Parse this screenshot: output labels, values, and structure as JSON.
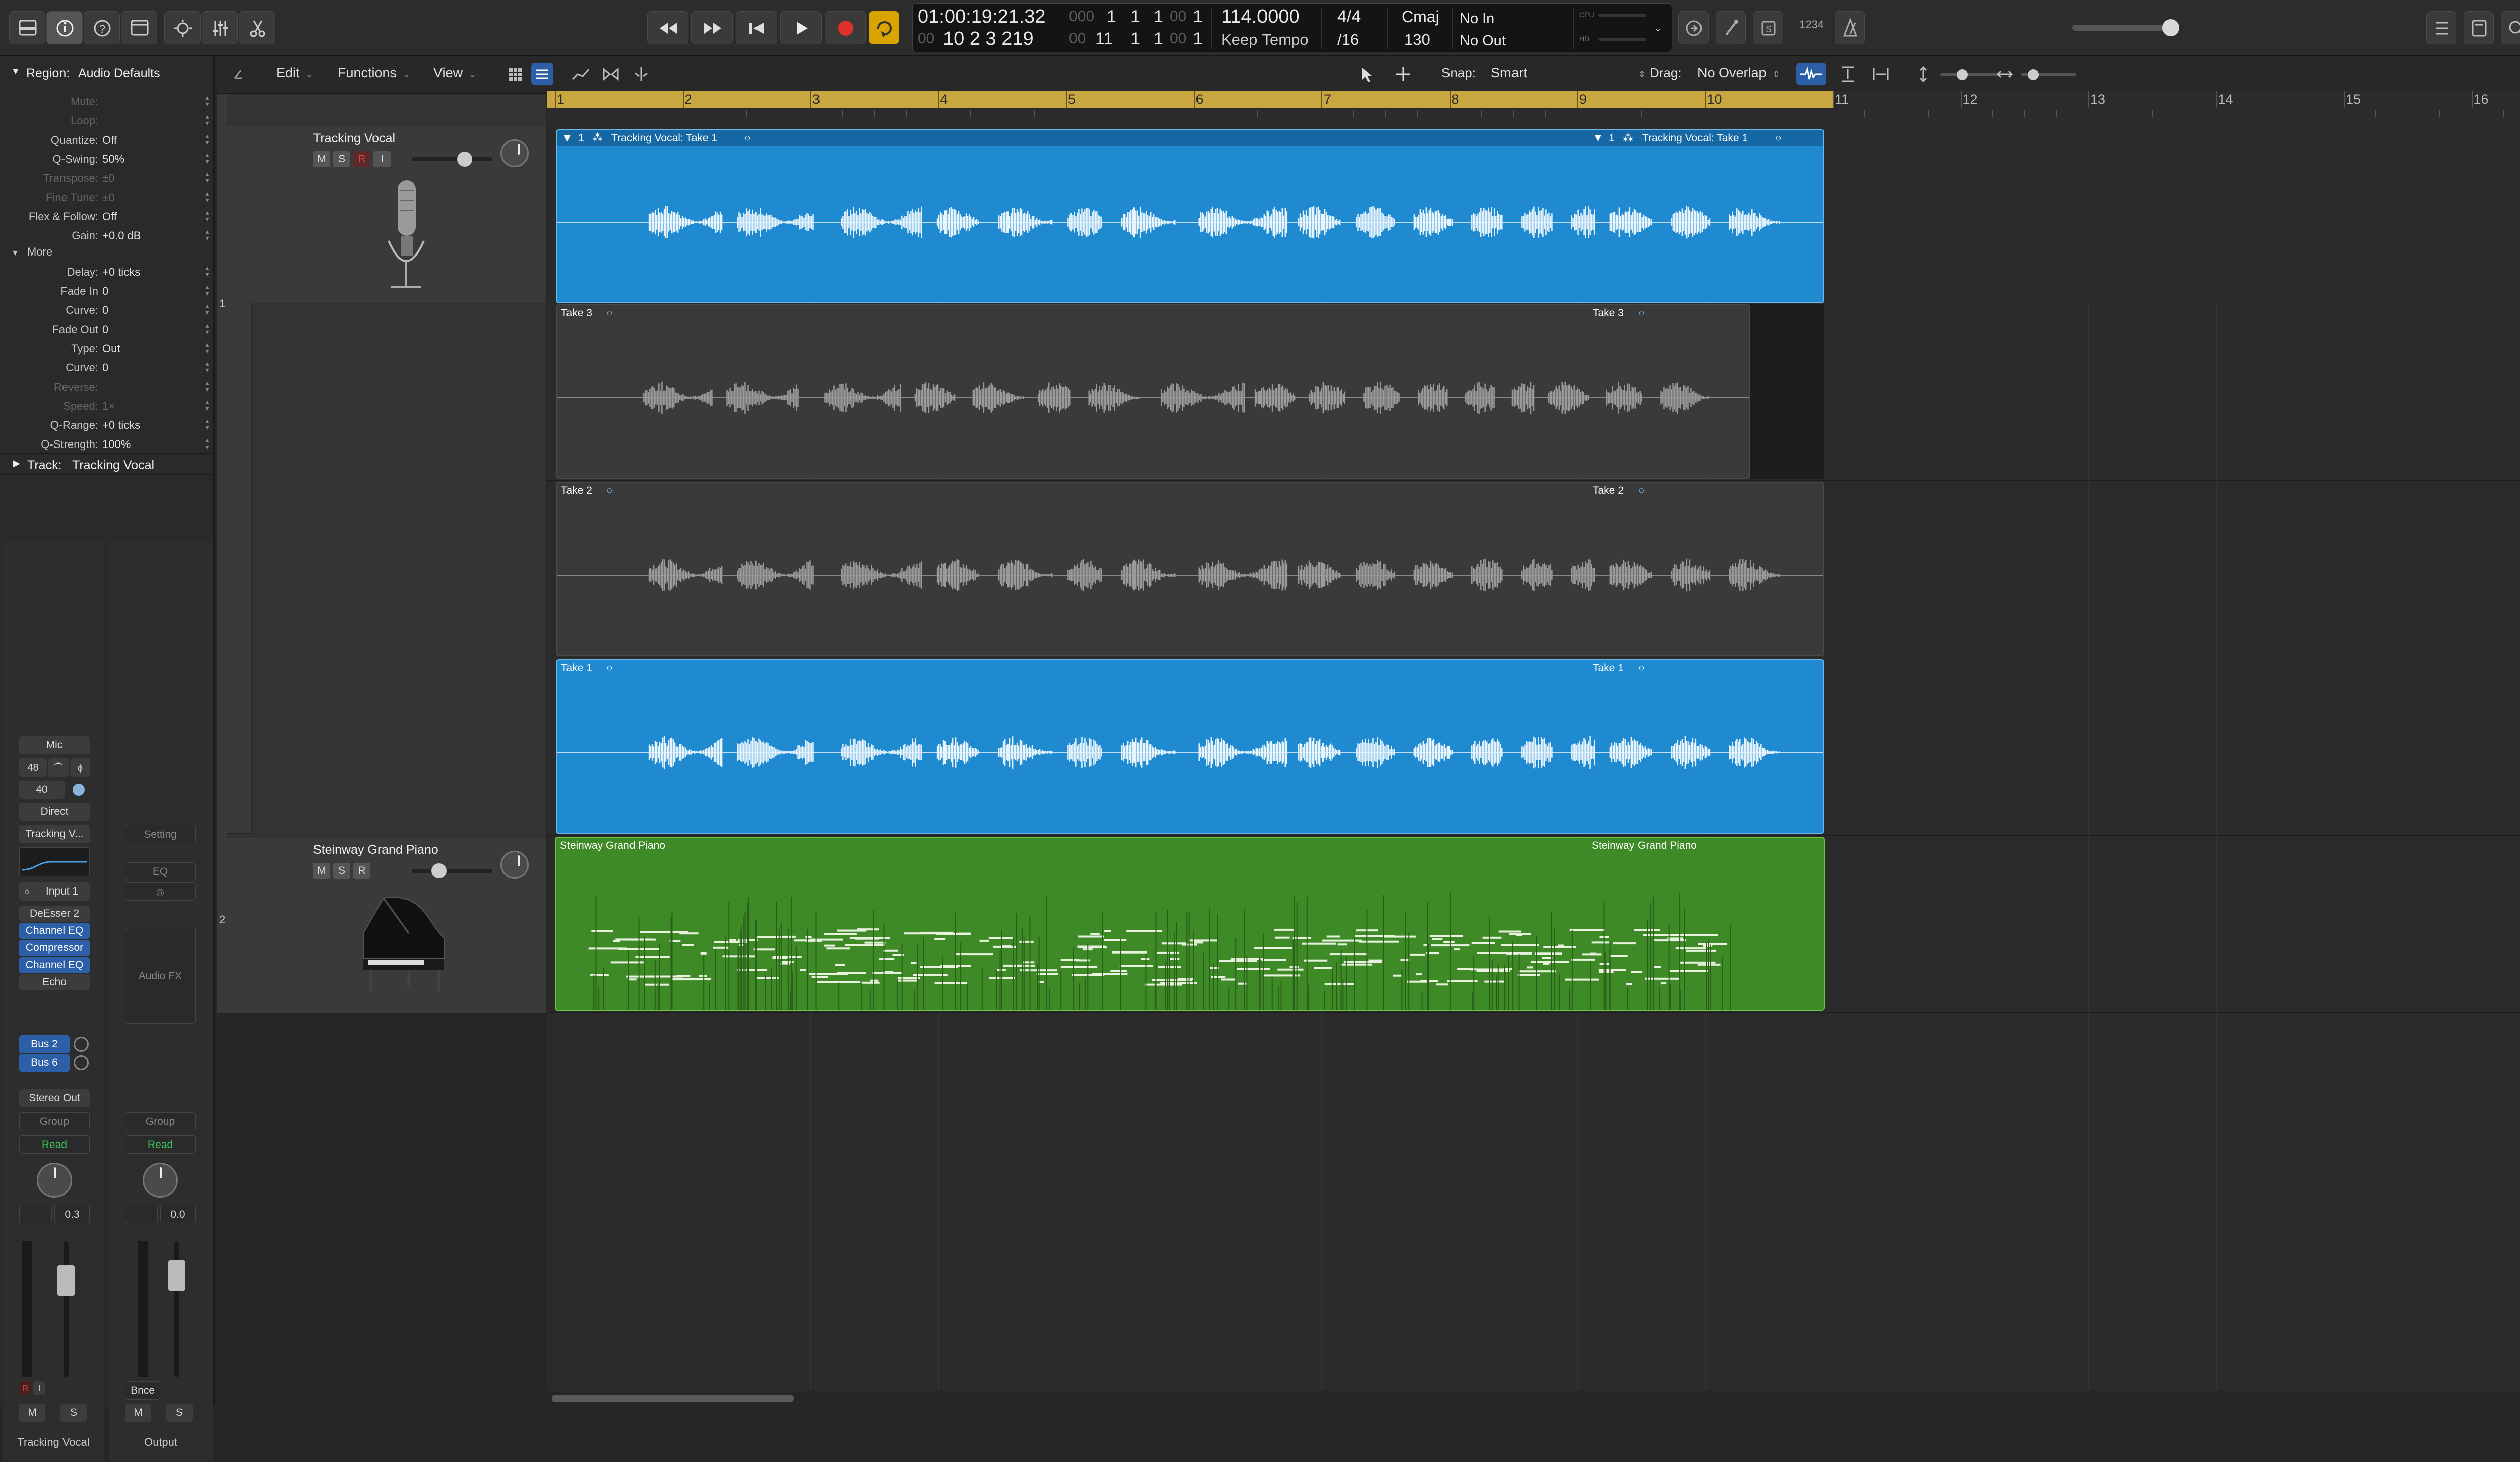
{
  "control_bar": {
    "lcd": {
      "smpte": "01:00:19:21.32",
      "bars_beats": "10 2 3 219",
      "bar": "1",
      "beat": "1",
      "div": "1",
      "tick": "1",
      "end_bar": "11",
      "end_beat": "1",
      "end_div": "1",
      "end_tick": "1",
      "tempo": "114.0000",
      "tempo_mode": "Keep Tempo",
      "time_sig": "4/4",
      "division": "/16",
      "key": "Cmaj",
      "key_value": "130",
      "midi_in": "No In",
      "midi_out": "No Out",
      "cpu_label": "CPU",
      "hd_label": "HD"
    },
    "badge_1234": "1234",
    "colors": {
      "record": "#e0302b",
      "cycle": "#d9a400",
      "blue_region": "#1f8ad0",
      "green_region": "#3d8a26",
      "cycle_ruler": "#c8a640"
    }
  },
  "toolbar": {
    "edit": "Edit",
    "functions": "Functions",
    "view": "View",
    "snap_label": "Snap:",
    "snap_value": "Smart",
    "drag_label": "Drag:",
    "drag_value": "No Overlap"
  },
  "inspector": {
    "region_header": "Region:",
    "region_name": "Audio Defaults",
    "params": [
      {
        "label": "Mute:",
        "value": "",
        "enabled": false
      },
      {
        "label": "Loop:",
        "value": "",
        "enabled": false
      },
      {
        "label": "Quantize:",
        "value": "Off",
        "enabled": true
      },
      {
        "label": "Q-Swing:",
        "value": "50%",
        "enabled": true
      },
      {
        "label": "Transpose:",
        "value": "±0",
        "enabled": false
      },
      {
        "label": "Fine Tune:",
        "value": "±0",
        "enabled": false
      },
      {
        "label": "Flex & Follow:",
        "value": "Off",
        "enabled": true
      },
      {
        "label": "Gain:",
        "value": "+0.0 dB",
        "enabled": true
      }
    ],
    "more_label": "More",
    "more_params": [
      {
        "label": "Delay:",
        "value": "+0 ticks",
        "enabled": true
      },
      {
        "label": "Fade In",
        "value": "0",
        "enabled": true
      },
      {
        "label": "Curve:",
        "value": "0",
        "enabled": true
      },
      {
        "label": "Fade Out",
        "value": "0",
        "enabled": true
      },
      {
        "label": "Type:",
        "value": "Out",
        "enabled": true
      },
      {
        "label": "Curve:",
        "value": "0",
        "enabled": true
      },
      {
        "label": "Reverse:",
        "value": "",
        "enabled": false
      },
      {
        "label": "Speed:",
        "value": "1×",
        "enabled": false
      },
      {
        "label": "Q-Range:",
        "value": "+0 ticks",
        "enabled": true
      },
      {
        "label": "Q-Strength:",
        "value": "100%",
        "enabled": true
      }
    ],
    "track_header": "Track:",
    "track_name": "Tracking Vocal"
  },
  "channel_strips": {
    "left": {
      "mic": "Mic",
      "gain": "48",
      "input_gain": "40",
      "direct": "Direct",
      "setting": "Tracking V...",
      "input": "Input 1",
      "plugins": [
        "DeEsser 2",
        "Channel EQ",
        "Compressor",
        "Channel EQ",
        "Echo"
      ],
      "sends": [
        "Bus 2",
        "Bus 6"
      ],
      "output": "Stereo Out",
      "group": "Group",
      "automation": "Read",
      "pan_value": "0.3",
      "mute": "M",
      "solo": "S",
      "name": "Tracking Vocal"
    },
    "right": {
      "setting": "Setting",
      "eq": "EQ",
      "audio_fx": "Audio FX",
      "group": "Group",
      "automation": "Read",
      "vol_value": "0.0",
      "bounce": "Bnce",
      "mute": "M",
      "solo": "S",
      "name": "Output"
    }
  },
  "tracks": [
    {
      "number": "1",
      "name": "Tracking Vocal",
      "buttons": [
        "M",
        "S",
        "R",
        "I"
      ]
    },
    {
      "number": "2",
      "name": "Steinway Grand Piano",
      "buttons": [
        "M",
        "S",
        "R"
      ]
    }
  ],
  "ruler": {
    "bars": [
      "1",
      "2",
      "3",
      "4",
      "5",
      "6",
      "7",
      "8",
      "9",
      "10",
      "11",
      "12",
      "13",
      "14",
      "15",
      "16"
    ]
  },
  "regions": {
    "comp": {
      "num": "1",
      "title": "Tracking Vocal: Take 1"
    },
    "take3": "Take 3",
    "take2": "Take 2",
    "take1": "Take 1",
    "piano": "Steinway Grand Piano"
  }
}
